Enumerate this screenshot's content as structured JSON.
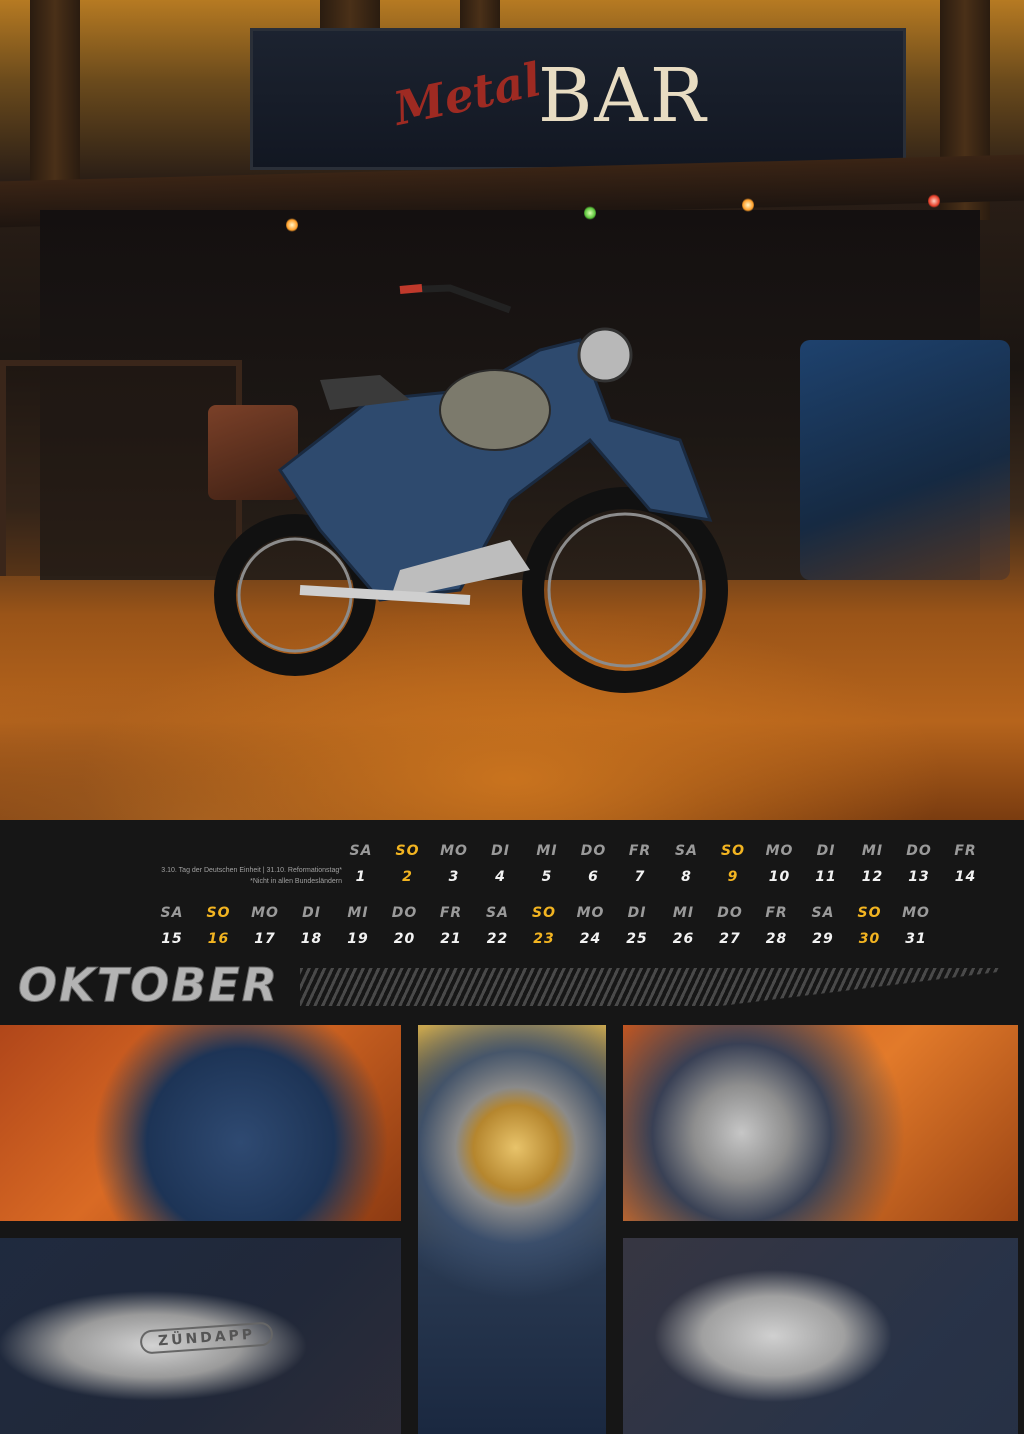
{
  "hero": {
    "sign_script": "Metal",
    "sign_text": "BAR"
  },
  "calendar": {
    "month": "OKTOBER",
    "holidays_line1": "3.10. Tag der Deutschen Einheit | 31.10. Reformationstag*",
    "holidays_line2": "*Nicht in allen Bundesländern",
    "row1": [
      {
        "day": "SA",
        "num": "1",
        "sunday": false
      },
      {
        "day": "SO",
        "num": "2",
        "sunday": true
      },
      {
        "day": "MO",
        "num": "3",
        "sunday": false
      },
      {
        "day": "DI",
        "num": "4",
        "sunday": false
      },
      {
        "day": "MI",
        "num": "5",
        "sunday": false
      },
      {
        "day": "DO",
        "num": "6",
        "sunday": false
      },
      {
        "day": "FR",
        "num": "7",
        "sunday": false
      },
      {
        "day": "SA",
        "num": "8",
        "sunday": false
      },
      {
        "day": "SO",
        "num": "9",
        "sunday": true
      },
      {
        "day": "MO",
        "num": "10",
        "sunday": false
      },
      {
        "day": "DI",
        "num": "11",
        "sunday": false
      },
      {
        "day": "MI",
        "num": "12",
        "sunday": false
      },
      {
        "day": "DO",
        "num": "13",
        "sunday": false
      },
      {
        "day": "FR",
        "num": "14",
        "sunday": false
      }
    ],
    "row2": [
      {
        "day": "SA",
        "num": "15",
        "sunday": false
      },
      {
        "day": "SO",
        "num": "16",
        "sunday": true
      },
      {
        "day": "MO",
        "num": "17",
        "sunday": false
      },
      {
        "day": "DI",
        "num": "18",
        "sunday": false
      },
      {
        "day": "MI",
        "num": "19",
        "sunday": false
      },
      {
        "day": "DO",
        "num": "20",
        "sunday": false
      },
      {
        "day": "FR",
        "num": "21",
        "sunday": false
      },
      {
        "day": "SA",
        "num": "22",
        "sunday": false
      },
      {
        "day": "SO",
        "num": "23",
        "sunday": true
      },
      {
        "day": "MO",
        "num": "24",
        "sunday": false
      },
      {
        "day": "DI",
        "num": "25",
        "sunday": false
      },
      {
        "day": "MI",
        "num": "26",
        "sunday": false
      },
      {
        "day": "DO",
        "num": "27",
        "sunday": false
      },
      {
        "day": "FR",
        "num": "28",
        "sunday": false
      },
      {
        "day": "SA",
        "num": "29",
        "sunday": false
      },
      {
        "day": "SO",
        "num": "30",
        "sunday": true
      },
      {
        "day": "MO",
        "num": "31",
        "sunday": false
      }
    ]
  },
  "photos": {
    "engine_label": "ZÜNDAPP"
  },
  "colors": {
    "background": "#161616",
    "sunday_accent": "#f2b421",
    "day_text": "#f2f2f2",
    "weekday_label": "#9a9a9a"
  }
}
